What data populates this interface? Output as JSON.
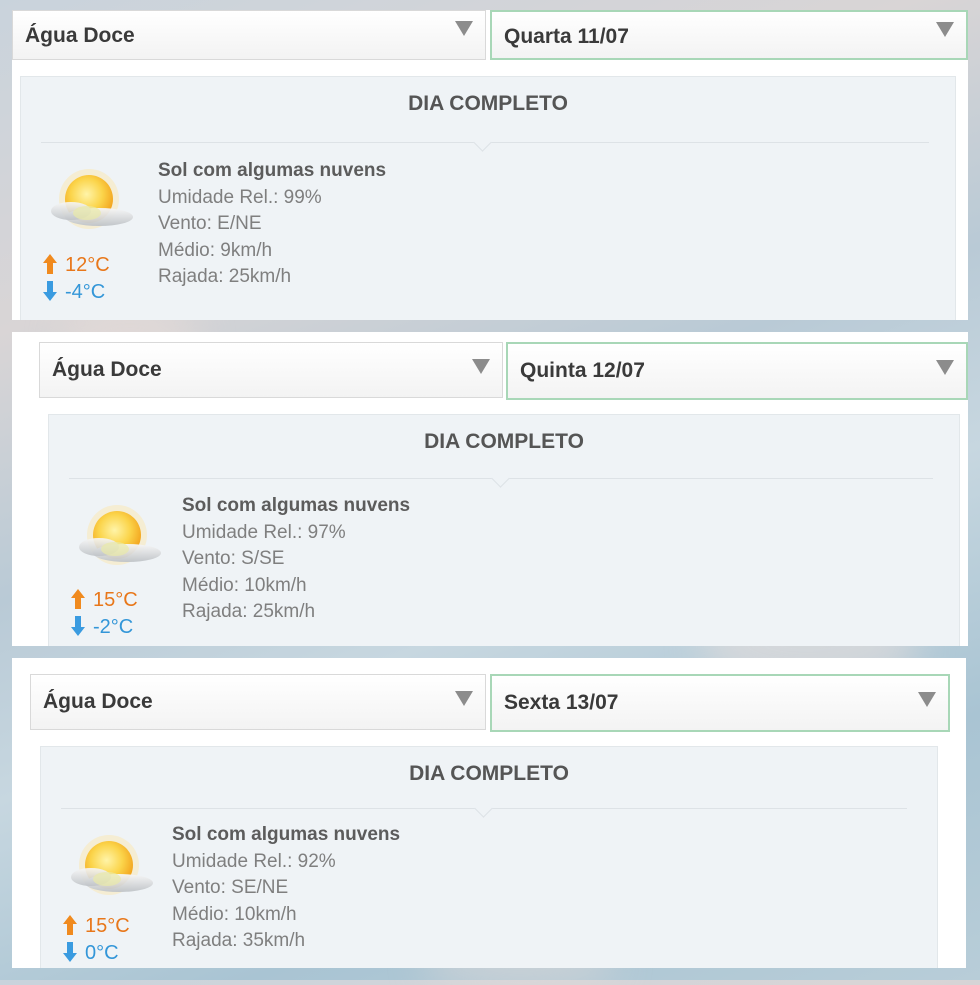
{
  "forecasts": [
    {
      "city": "Água Doce",
      "date": "Quarta 11/07",
      "section_title": "DIA COMPLETO",
      "condition": "Sol com algumas nuvens",
      "icon": "sun-with-clouds-icon",
      "humidity": "Umidade Rel.: 99%",
      "wind": "Vento: E/NE",
      "wind_avg": "Médio: 9km/h",
      "wind_gust": "Rajada: 25km/h",
      "temp_max": "12°C",
      "temp_min": "-4°C"
    },
    {
      "city": "Água Doce",
      "date": "Quinta 12/07",
      "section_title": "DIA COMPLETO",
      "condition": "Sol com algumas nuvens",
      "icon": "sun-with-clouds-icon",
      "humidity": "Umidade Rel.: 97%",
      "wind": "Vento: S/SE",
      "wind_avg": "Médio: 10km/h",
      "wind_gust": "Rajada: 25km/h",
      "temp_max": "15°C",
      "temp_min": "-2°C"
    },
    {
      "city": "Água Doce",
      "date": "Sexta 13/07",
      "section_title": "DIA COMPLETO",
      "condition": "Sol com algumas nuvens",
      "icon": "sun-with-clouds-icon",
      "humidity": "Umidade Rel.: 92%",
      "wind": "Vento: SE/NE",
      "wind_avg": "Médio: 10km/h",
      "wind_gust": "Rajada: 35km/h",
      "temp_max": "15°C",
      "temp_min": "0°C"
    }
  ],
  "colors": {
    "temp_max": "#e8771a",
    "temp_min": "#3396d8",
    "date_select_border": "#a8d7b7",
    "card_background": "#eff3f6"
  }
}
